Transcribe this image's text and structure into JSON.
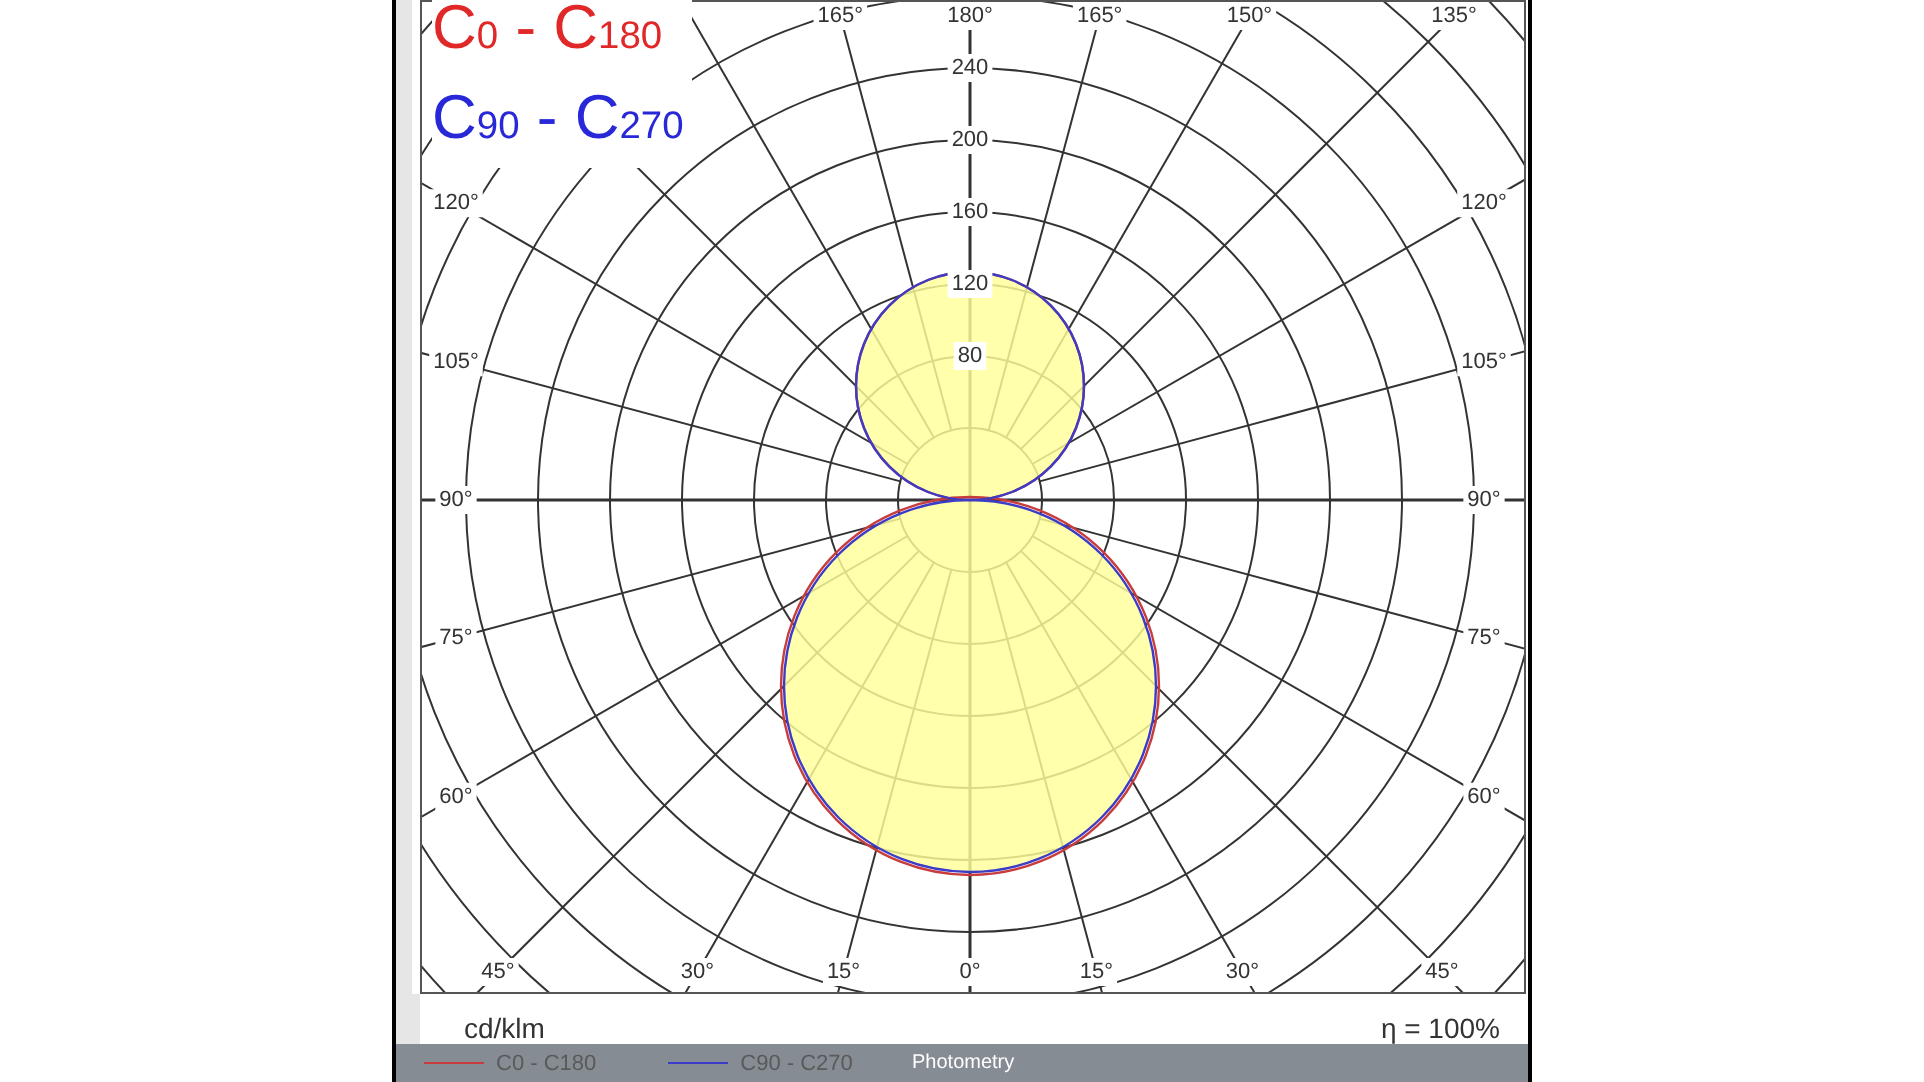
{
  "legend_title": [
    {
      "text": "C$_{0}$ - C$_{180}$",
      "color": "#e02828"
    },
    {
      "text": "C$_{90}$ - C$_{270}$",
      "color": "#2828d8"
    }
  ],
  "diagram": {
    "ring_labels": [
      "240",
      "200",
      "160",
      "120",
      "80"
    ],
    "angle_labels_top": [
      "165°",
      "180°",
      "165°",
      "150°",
      "135°"
    ],
    "angle_labels_left": [
      "120°",
      "105°",
      "90°",
      "75°",
      "60°"
    ],
    "angle_labels_right": [
      "120°",
      "105°",
      "90°",
      "75°",
      "60°"
    ],
    "angle_labels_bottom": [
      "45°",
      "30°",
      "15°",
      "0°",
      "15°",
      "30°",
      "45°"
    ]
  },
  "unit": "cd/klm",
  "efficiency": "η = 100%",
  "series": [
    {
      "label": "C0 - C180",
      "color": "#c83c3c"
    },
    {
      "label": "C90 - C270",
      "color": "#3c3cc8"
    }
  ],
  "caption": "Photometry"
}
